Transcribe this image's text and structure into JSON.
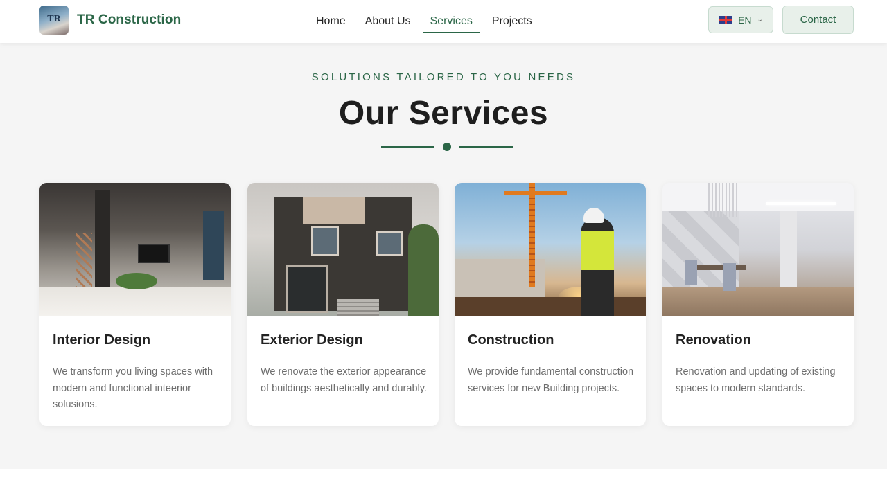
{
  "header": {
    "brand_name": "TR Construction",
    "logo_text": "TR",
    "nav": [
      {
        "label": "Home",
        "active": false
      },
      {
        "label": "About Us",
        "active": false
      },
      {
        "label": "Services",
        "active": true
      },
      {
        "label": "Projects",
        "active": false
      }
    ],
    "language": {
      "code": "EN",
      "flag_icon": "uk-flag-icon"
    },
    "contact_label": "Contact"
  },
  "services_section": {
    "eyebrow": "SOLUTIONS TAILORED TO YOU NEEDS",
    "title": "Our Services",
    "cards": [
      {
        "title": "Interior Design",
        "description": "We transform you living spaces with modern and functional inteerior solusions."
      },
      {
        "title": "Exterior Design",
        "description": "We renovate the exterior appearance of buildings aesthetically and durably."
      },
      {
        "title": "Construction",
        "description": "We provide fundamental construction services for new Building projects."
      },
      {
        "title": "Renovation",
        "description": "Renovation and updating of existing spaces to modern standards."
      }
    ]
  },
  "colors": {
    "brand_green": "#2b6647",
    "button_bg": "#e8f0ea",
    "page_bg": "#f5f5f5"
  }
}
